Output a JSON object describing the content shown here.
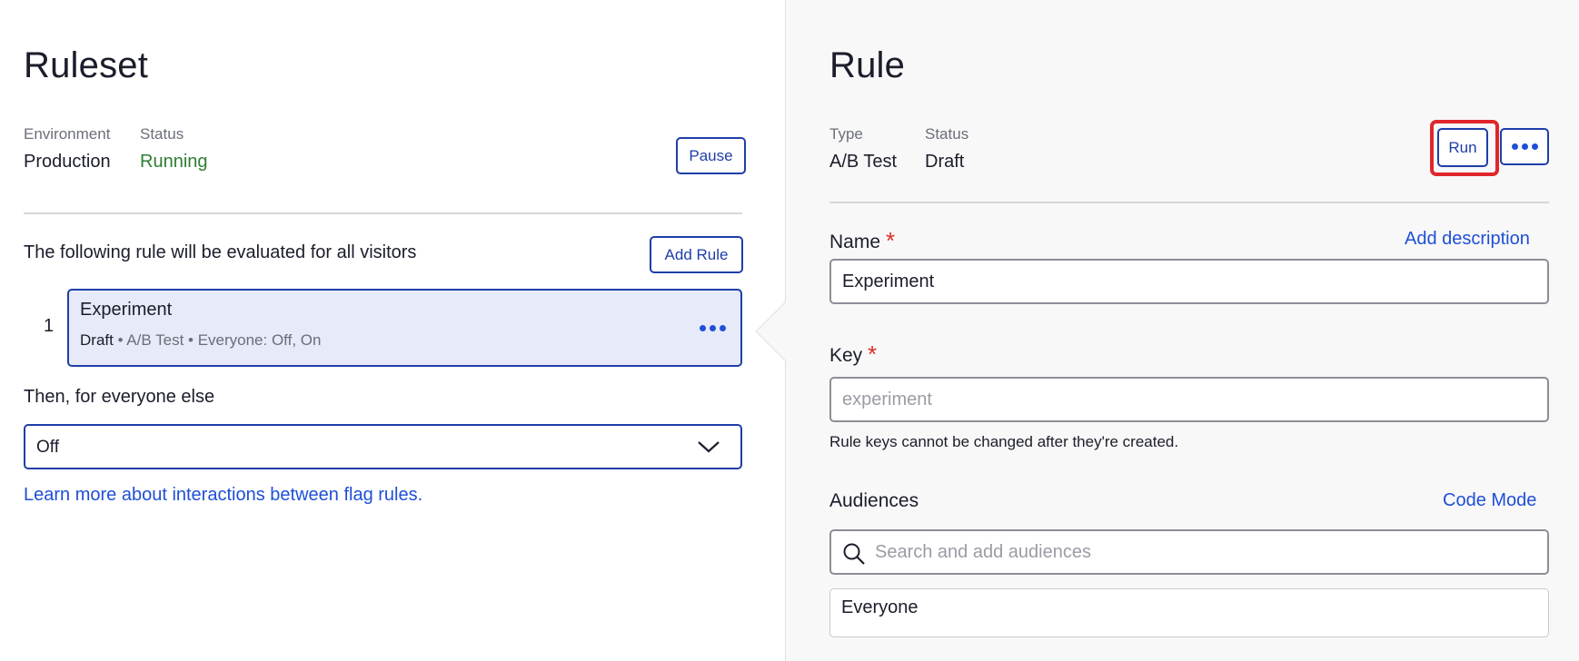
{
  "left": {
    "title": "Ruleset",
    "environment_label": "Environment",
    "environment_value": "Production",
    "status_label": "Status",
    "status_value": "Running",
    "pause_label": "Pause",
    "evaluated_text": "The following rule will be evaluated for all visitors",
    "add_rule_label": "Add Rule",
    "rule": {
      "number": "1",
      "name": "Experiment",
      "status": "Draft",
      "details": " • A/B Test • Everyone: Off, On"
    },
    "everyone_else_label": "Then, for everyone else",
    "everyone_else_value": "Off",
    "learn_more": "Learn more about interactions between flag rules."
  },
  "right": {
    "title": "Rule",
    "type_label": "Type",
    "type_value": "A/B Test",
    "status_label": "Status",
    "status_value": "Draft",
    "run_label": "Run",
    "name_label": "Name",
    "required_mark": "*",
    "add_description": "Add description",
    "name_value": "Experiment",
    "key_label": "Key",
    "key_placeholder": "experiment",
    "key_hint": "Rule keys cannot be changed after they're created.",
    "audiences_label": "Audiences",
    "code_mode": "Code Mode",
    "audience_search_placeholder": "Search and add audiences",
    "audience_selected": "Everyone"
  },
  "colors": {
    "accent": "#1f3ea8",
    "link": "#1f4fd6",
    "running": "#2f7d32",
    "required": "#d93025",
    "highlight": "#e0262b"
  }
}
